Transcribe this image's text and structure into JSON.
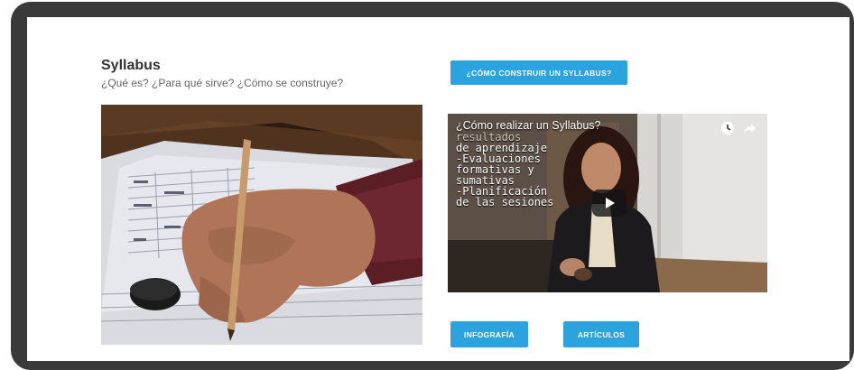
{
  "header": {
    "title": "Syllabus",
    "subtitle": "¿Qué es? ¿Para qué sirve? ¿Cómo se construye?"
  },
  "buttons": {
    "syllabus": "¿CÓMO CONSTRUIR UN SYLLABUS?",
    "infografia": "INFOGRAFÍA",
    "articulos": "ARTÍCULOS"
  },
  "video": {
    "title": "¿Cómo realizar un Syllabus?",
    "overlay_lines": [
      "resultados",
      "de aprendizaje",
      "-Evaluaciones",
      "formativas y",
      "sumativas",
      "-Planificación",
      "de las sesiones"
    ]
  },
  "icons": {
    "clock": "clock-icon",
    "share": "share-icon",
    "play": "play-icon"
  },
  "colors": {
    "accent": "#2aa3df",
    "frame": "#3a3a3a"
  }
}
